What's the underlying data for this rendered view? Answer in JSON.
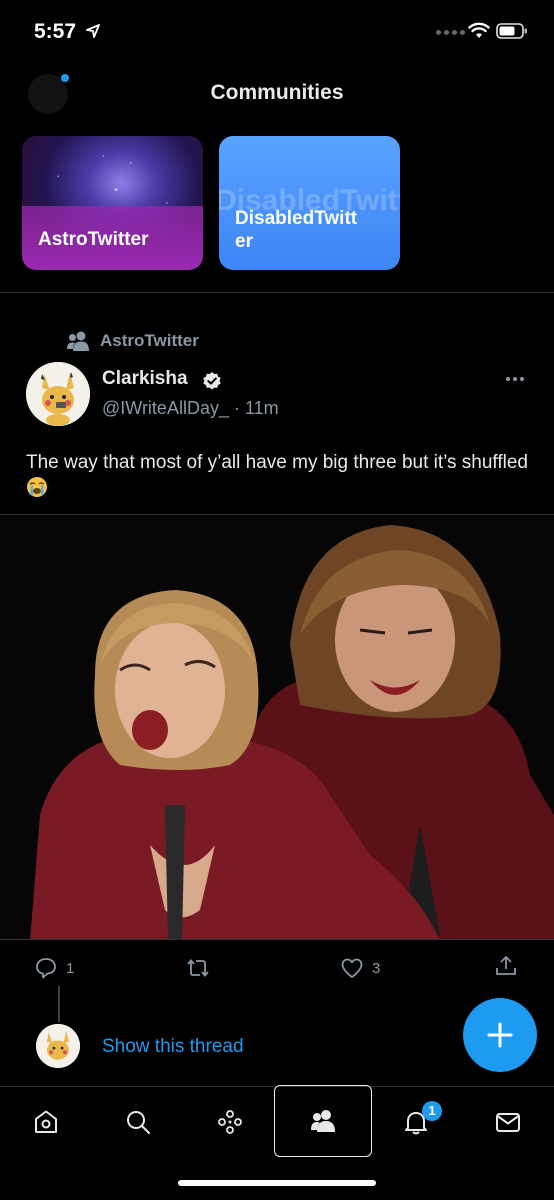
{
  "status_bar": {
    "time": "5:57"
  },
  "header": {
    "title": "Communities"
  },
  "communities": [
    {
      "name": "AstroTwitter"
    },
    {
      "name": "DisabledTwitter",
      "name_wrapped": "DisabledTwitt\ner"
    }
  ],
  "tweet": {
    "community_context": "AstroTwitter",
    "author_name": "Clarkisha",
    "handle_time": "@IWriteAllDay_ · 11m",
    "text": "The way that most of y’all have my big three but it’s shuffled",
    "actions": {
      "reply_count": "1",
      "retweet_count": "",
      "like_count": "3"
    }
  },
  "thread": {
    "show_label": "Show this thread"
  },
  "tab_bar": {
    "notifications_badge": "1"
  },
  "colors": {
    "accent": "#1d9bf0",
    "background": "#000000",
    "secondary_text": "#8b98a5"
  }
}
